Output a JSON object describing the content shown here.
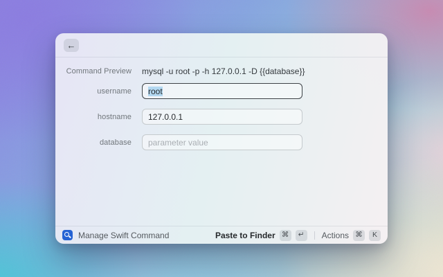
{
  "window": {
    "header": {
      "back_icon": "←"
    },
    "preview": {
      "label": "Command Preview",
      "command": "mysql -u root -p -h 127.0.0.1 -D {{database}}"
    },
    "form": {
      "fields": [
        {
          "label": "username",
          "value": "root",
          "placeholder": "",
          "state": "focused-selected"
        },
        {
          "label": "hostname",
          "value": "127.0.0.1",
          "placeholder": "",
          "state": "normal"
        },
        {
          "label": "database",
          "value": "",
          "placeholder": "parameter value",
          "state": "empty"
        }
      ]
    },
    "footer": {
      "app_icon": "swift-command-app-icon",
      "app_name": "Manage Swift Command",
      "primary_action": {
        "label": "Paste to Finder",
        "keys": [
          "⌘",
          "↵"
        ]
      },
      "secondary_action": {
        "label": "Actions",
        "keys": [
          "⌘",
          "K"
        ]
      }
    }
  },
  "colors": {
    "accent_blue": "#2563d4",
    "selection_highlight": "#b3d8f1",
    "focused_border": "#3e4347",
    "field_border": "#c5cacd",
    "wallpaper_purple": "#8b7ce0",
    "wallpaper_pink": "#ca88b0",
    "wallpaper_teal": "#48c7d6",
    "wallpaper_cream": "#eee6d3"
  }
}
